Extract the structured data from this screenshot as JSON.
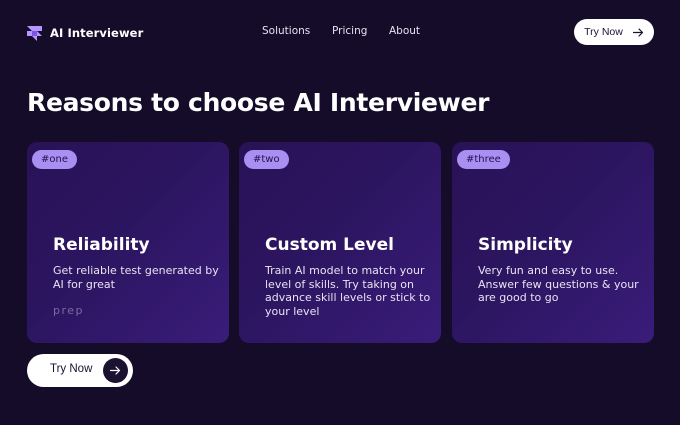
{
  "brand": {
    "name": "AI Interviewer",
    "icon": "logo-icon"
  },
  "nav": {
    "links": [
      "Solutions",
      "Pricing",
      "About"
    ]
  },
  "header_cta": {
    "label": "Try Now",
    "icon": "arrow-right-icon"
  },
  "hero": {
    "title": "Reasons to choose AI Interviewer"
  },
  "cards": [
    {
      "tag": "#one",
      "title": "Reliability",
      "text": "Get reliable test generated by AI for great",
      "faded": "prep"
    },
    {
      "tag": "#two",
      "title": "Custom Level",
      "text": "Train AI model to match your level of skills. Try taking on advance skill levels or stick to your level"
    },
    {
      "tag": "#three",
      "title": "Simplicity",
      "text": "Very fun and easy to use. Answer few questions & your are good to go"
    }
  ],
  "bottom_cta": {
    "label": "Try Now",
    "icon": "arrow-right-icon"
  },
  "colors": {
    "background": "#150c29",
    "card": "#2c1560",
    "tag": "#a98ff2",
    "button": "#ffffff"
  }
}
